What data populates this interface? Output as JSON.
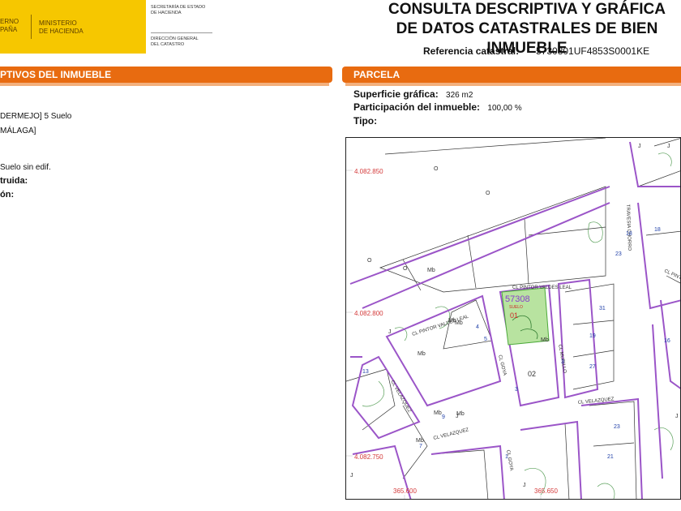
{
  "header": {
    "gov_text": [
      "ERNO",
      "PAÑA"
    ],
    "ministry_text": [
      "MINISTERIO",
      "DE HACIENDA"
    ],
    "secretaria": [
      "SECRETARÍA DE ESTADO",
      "DE HACIENDA"
    ],
    "direccion": [
      "DIRECCIÓN GENERAL",
      "DEL CATASTRO"
    ],
    "title_line1": "CONSULTA DESCRIPTIVA Y GRÁFICA",
    "title_line2": "DE DATOS CATASTRALES DE BIEN INMUEBLE",
    "ref_label": "Referencia catastral:",
    "ref_value": "5730801UF4853S0001KE"
  },
  "left_section": {
    "title": "PTIVOS DEL INMUEBLE",
    "lines": [
      "DERMEJO] 5 Suelo",
      "MÁLAGA]",
      "Suelo sin edif."
    ],
    "bold_lines": [
      "truida:",
      "ón:"
    ]
  },
  "parcela": {
    "title": "PARCELA",
    "superficie_label": "Superficie gráfica:",
    "superficie_value": "326 m2",
    "participacion_label": "Participación del inmueble:",
    "participacion_value": "100,00 %",
    "tipo_label": "Tipo:"
  },
  "map": {
    "coords": [
      "4.082.850",
      "4.082.800",
      "4.082.750",
      "365.600",
      "365.650"
    ],
    "parcel_id": "57308",
    "parcel_sub": "SUELO",
    "parcel_num": "01",
    "other_num": "02",
    "streets": [
      "CL PINTOR VALDES LEAL",
      "CL PINTOR VALDES LEAL",
      "CL GOYA",
      "CL MURILLO",
      "CL VELAZQUEZ",
      "CL VELAZQUEZ",
      "CL VELAZQUEZ",
      "CL GOYA",
      "TRAVESIA CHORRO",
      "CL PINTOR"
    ],
    "mb_label": "Mb",
    "house_numbers": [
      "18",
      "23",
      "31",
      "4",
      "5",
      "3",
      "19",
      "27",
      "23",
      "7",
      "13",
      "9",
      "16",
      "21",
      "18",
      "1",
      "3"
    ],
    "letters": [
      "O",
      "O",
      "O",
      "O",
      "J",
      "J",
      "J",
      "J",
      "J",
      "J",
      "J"
    ]
  }
}
